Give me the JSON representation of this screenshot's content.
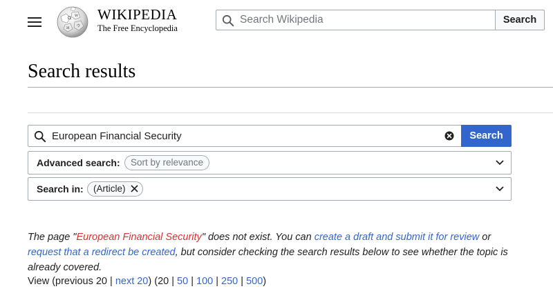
{
  "header": {
    "wordmark_title": "WIKIPEDIA",
    "wordmark_tagline": "The Free Encyclopedia",
    "search_placeholder": "Search Wikipedia",
    "search_button": "Search"
  },
  "page": {
    "title": "Search results"
  },
  "search_form": {
    "query": "European Financial Security",
    "search_button": "Search",
    "advanced_label": "Advanced search:",
    "sort_chip": "Sort by relevance",
    "search_in_label": "Search in:",
    "namespace_chip": "(Article)"
  },
  "notice": {
    "text_1": "The page \"",
    "page_link": "European Financial Security",
    "text_2": "\" does not exist. You can ",
    "draft_link": "create a draft and submit it for review",
    "text_3": " or ",
    "redirect_link": "request that a redirect be created",
    "text_4": ", but consider checking the search results below to see whether the topic is already covered."
  },
  "paging": {
    "prefix": "View (previous 20 | ",
    "next_link": "next 20",
    "middle": ") (20 | ",
    "opt_50": "50",
    "sep1": " | ",
    "opt_100": "100",
    "sep2": " | ",
    "opt_250": "250",
    "sep3": " | ",
    "opt_500": "500",
    "suffix": ")"
  },
  "colors": {
    "primary": "#3366cc",
    "missing_link": "#d73333",
    "border": "#a2a9b1"
  },
  "icons": {
    "menu": "hamburger-menu-icon",
    "logo": "wikipedia-globe-logo",
    "search": "magnifier-icon",
    "clear": "clear-circle-x-icon",
    "chevron": "chevron-down-icon",
    "chip_remove": "x-icon"
  }
}
